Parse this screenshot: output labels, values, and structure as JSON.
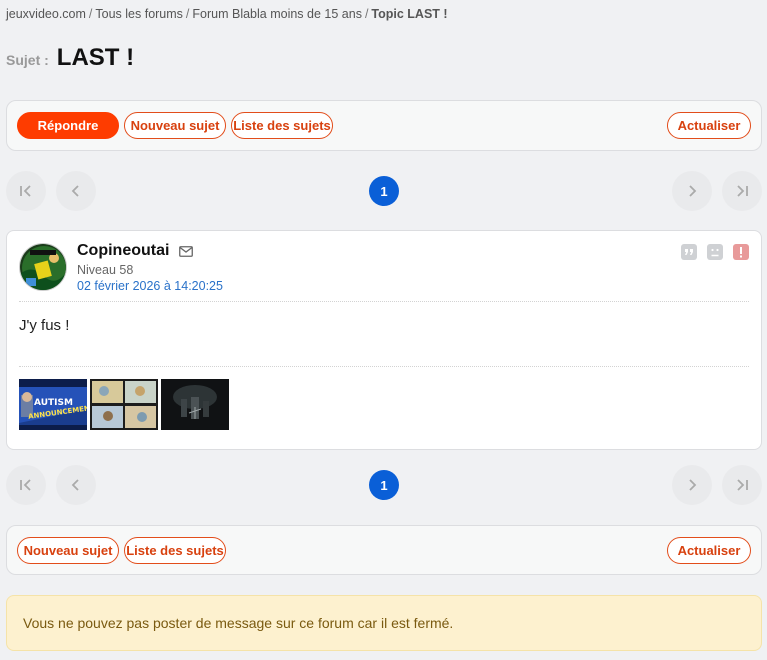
{
  "breadcrumb": {
    "items": [
      "jeuxvideo.com",
      "Tous les forums",
      "Forum Blabla moins de 15 ans"
    ],
    "separator": "/",
    "current": "Topic LAST !"
  },
  "subject": {
    "label": "Sujet :",
    "title": "LAST !"
  },
  "toolbar_top": {
    "reply": "Répondre",
    "new_topic": "Nouveau sujet",
    "topic_list": "Liste des sujets",
    "refresh": "Actualiser"
  },
  "pagination": {
    "current_page": "1",
    "first_icon": "first-page-icon",
    "prev_icon": "prev-page-icon",
    "next_icon": "next-page-icon",
    "last_icon": "last-page-icon"
  },
  "post": {
    "author": "Copineoutai",
    "level": "Niveau 58",
    "date": "02 février 2026 à 14:20:25",
    "content": "J'y fus !",
    "action_icons": [
      "quote-icon",
      "sad-face-icon",
      "report-icon"
    ],
    "thumbnails": [
      {
        "name": "thumbnail-autism-announcement",
        "caption_line1": "AUTISM",
        "caption_line2": "ANNOUNCEMENT"
      },
      {
        "name": "thumbnail-comic"
      },
      {
        "name": "thumbnail-dark-scene"
      }
    ]
  },
  "toolbar_bottom": {
    "new_topic": "Nouveau sujet",
    "topic_list": "Liste des sujets",
    "refresh": "Actualiser"
  },
  "notice": "Vous ne pouvez pas poster de message sur ce forum car il est fermé.",
  "colors": {
    "accent": "#fe3c00",
    "page_active": "#0a5fd7",
    "date_link": "#2a72c9",
    "notice_bg": "#fdf1cf"
  }
}
